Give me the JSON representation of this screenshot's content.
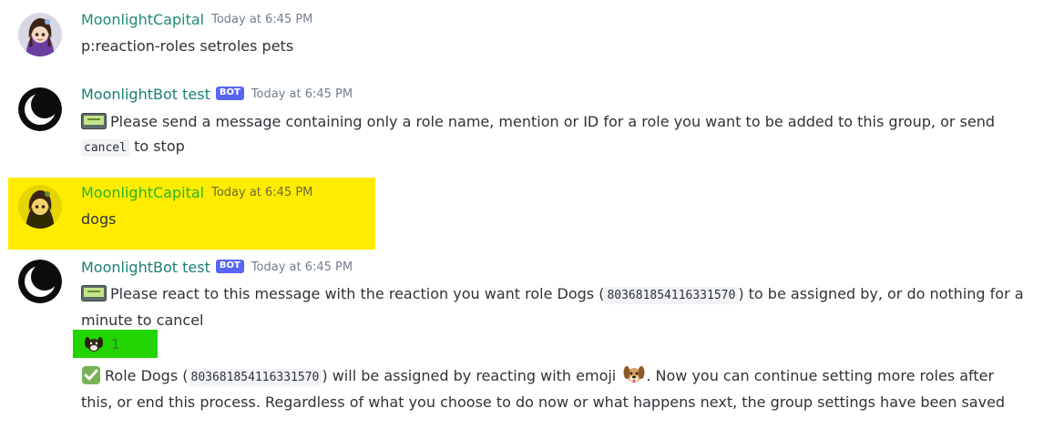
{
  "messages": [
    {
      "username": "MoonlightCapital",
      "timestamp": "Today at 6:45 PM",
      "text": "p:reaction-roles setroles pets"
    },
    {
      "username": "MoonlightBot test",
      "bot_tag": "BOT",
      "timestamp": "Today at 6:45 PM",
      "text_1": "Please send a message containing only a role name, mention or ID for a role you want to be added to this group, or send",
      "code": "cancel",
      "text_2": "to stop"
    },
    {
      "username": "MoonlightCapital",
      "timestamp": "Today at 6:45 PM",
      "text": "dogs"
    },
    {
      "username": "MoonlightBot test",
      "bot_tag": "BOT",
      "timestamp": "Today at 6:45 PM",
      "text_1": "Please react to this message with the reaction you want role Dogs (",
      "code_1": "803681854116331570",
      "text_2": ") to be assigned by, or do nothing for a minute to cancel",
      "reaction_count": "1",
      "confirm_1": "Role Dogs (",
      "code_2": "803681854116331570",
      "confirm_2": ") will be assigned by reacting with emoji",
      "confirm_3": ". Now you can continue setting more roles after this, or end this process. Regardless of what you choose to do now or what happens next, the group settings have been saved"
    }
  ],
  "icons": {
    "pager": "pager-emoji-icon",
    "check": "white-check-mark-emoji-icon",
    "dog": "dog-emoji-icon",
    "moon": "crescent-moon-avatar"
  },
  "colors": {
    "highlight_yellow": "#ffec00",
    "highlight_green": "#22d400",
    "bot_tag": "#5865f2",
    "username_capital": "#1f8b6f",
    "username_bot": "#1a7f73"
  }
}
